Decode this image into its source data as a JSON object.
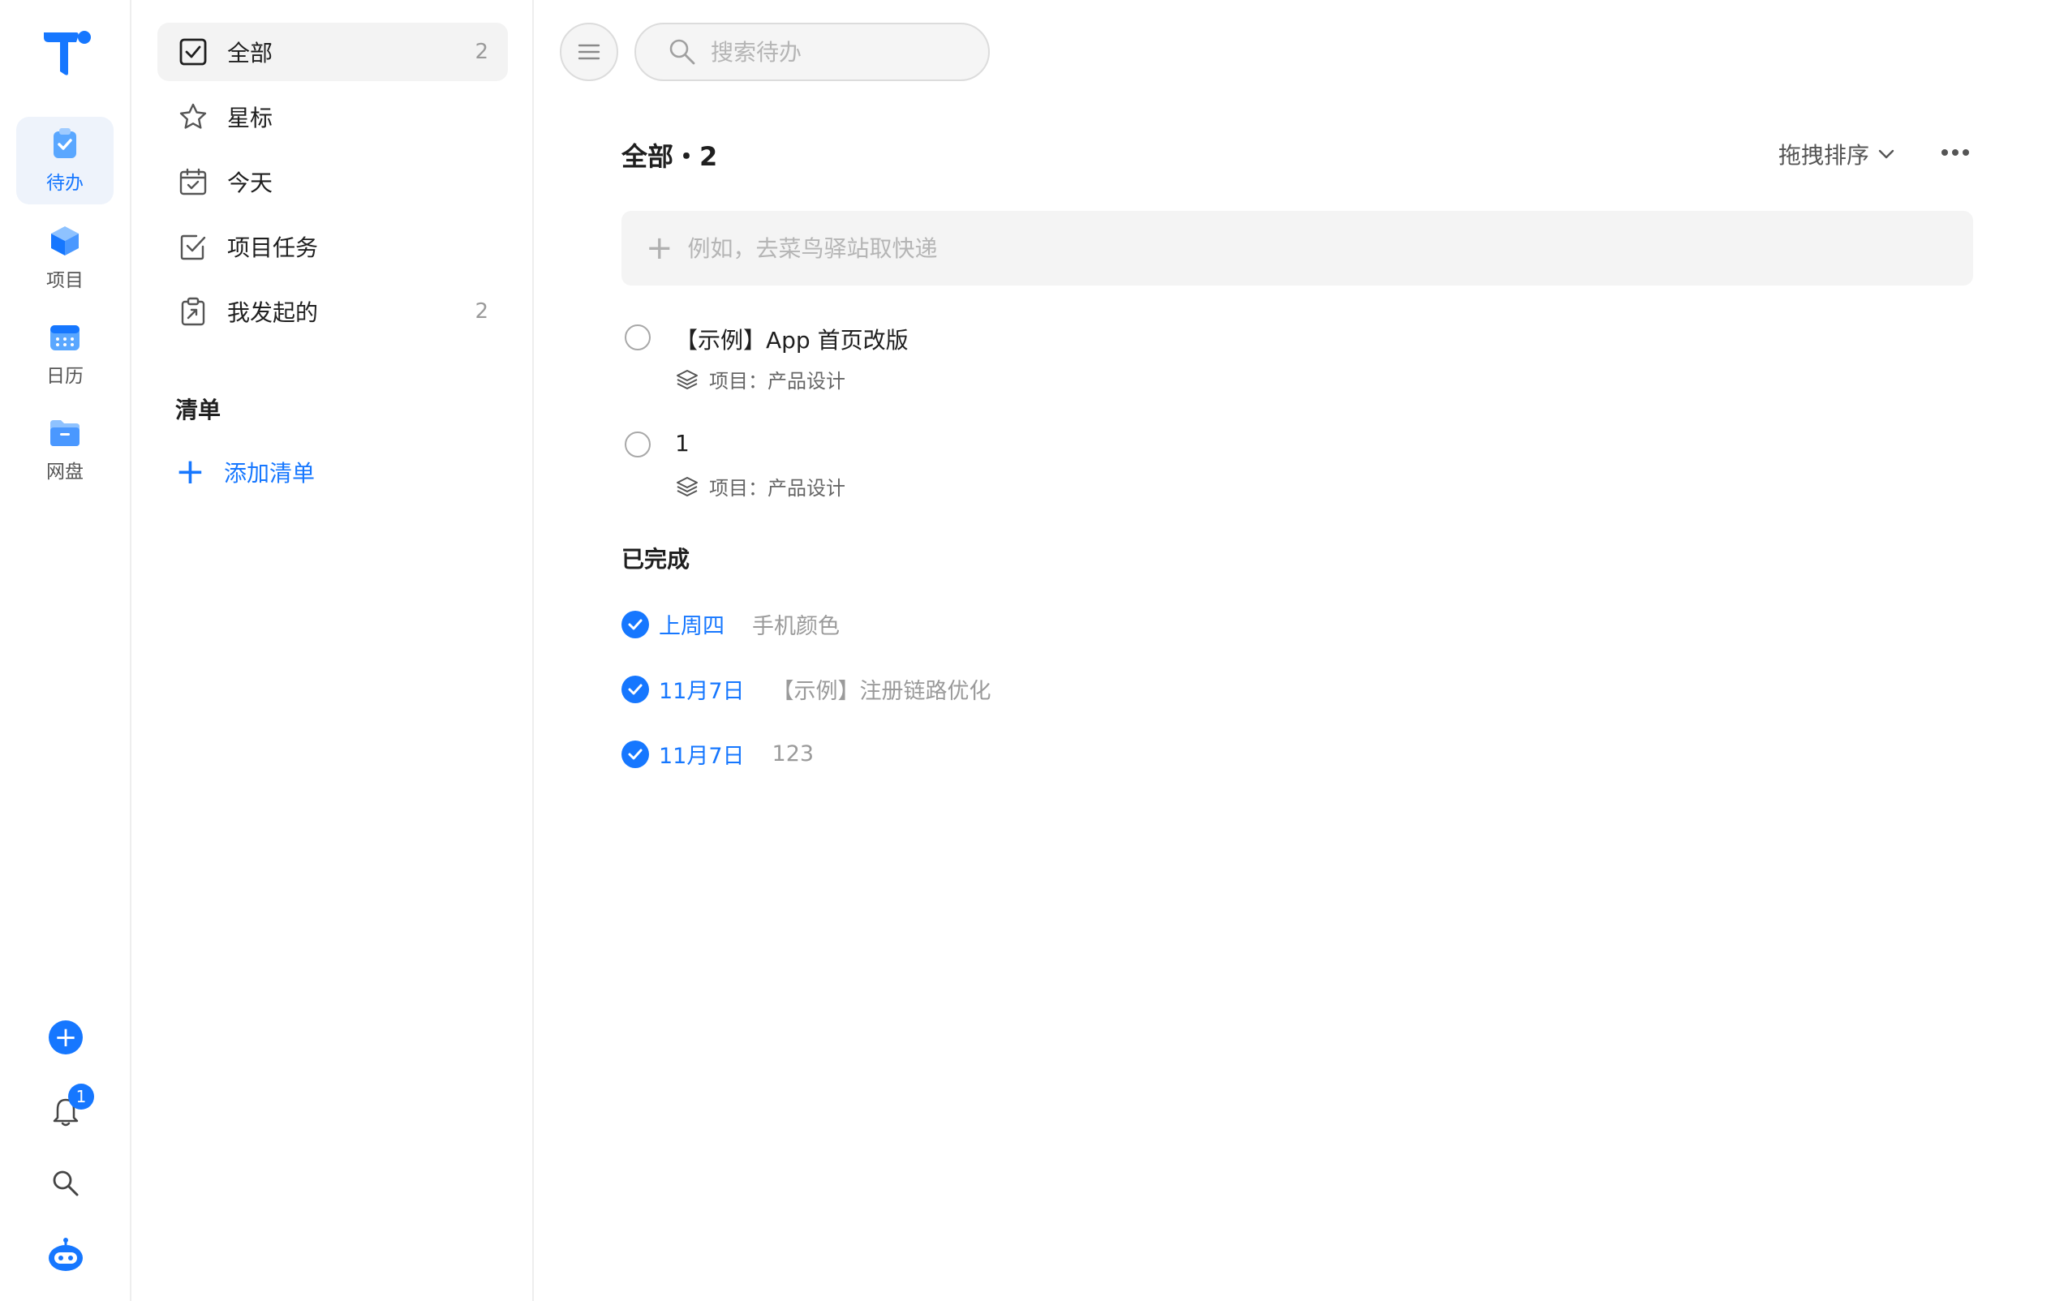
{
  "rail": {
    "items": [
      {
        "label": "待办",
        "icon": "clipboard-check-icon",
        "active": true
      },
      {
        "label": "项目",
        "icon": "cube-icon"
      },
      {
        "label": "日历",
        "icon": "calendar-icon"
      },
      {
        "label": "网盘",
        "icon": "folder-icon"
      }
    ],
    "add_label": "+",
    "notification_count": "1",
    "accent": "#1677ff"
  },
  "sidebar": {
    "items": [
      {
        "label": "全部",
        "count": "2",
        "icon": "checkbox-icon",
        "active": true
      },
      {
        "label": "星标",
        "count": "",
        "icon": "star-icon"
      },
      {
        "label": "今天",
        "count": "",
        "icon": "calendar-check-icon"
      },
      {
        "label": "项目任务",
        "count": "",
        "icon": "task-check-icon"
      },
      {
        "label": "我发起的",
        "count": "2",
        "icon": "clipboard-share-icon"
      }
    ],
    "section_title": "清单",
    "add_list_label": "添加清单"
  },
  "main": {
    "search_placeholder": "搜索待办",
    "title": "全部・2",
    "sort_label": "拖拽排序",
    "quick_add_placeholder": "例如，去菜鸟驿站取快递",
    "tasks": [
      {
        "title": "【示例】App 首页改版",
        "meta": "项目：产品设计"
      },
      {
        "title": "1",
        "meta": "项目：产品设计"
      }
    ],
    "done_title": "已完成",
    "done": [
      {
        "date": "上周四",
        "title": "手机颜色"
      },
      {
        "date": "11月7日",
        "title": "【示例】注册链路优化"
      },
      {
        "date": "11月7日",
        "title": "123"
      }
    ]
  }
}
